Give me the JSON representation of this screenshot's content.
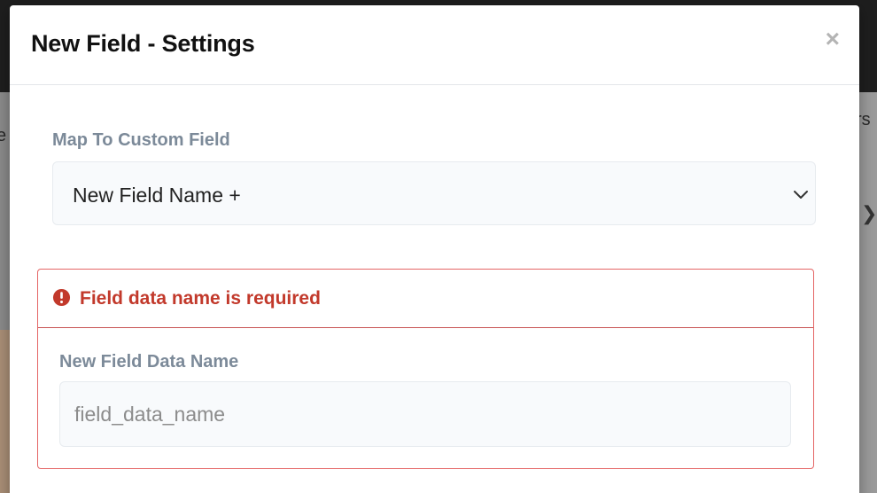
{
  "background": {
    "left_fragment": "e",
    "right_fragment": "rs",
    "right_arrow": "❯"
  },
  "modal": {
    "title": "New Field - Settings",
    "close_icon": "×"
  },
  "map_field": {
    "label": "Map To Custom Field",
    "selected_value": "New Field Name +"
  },
  "error": {
    "message": "Field data name is required",
    "color": "#c2392b"
  },
  "data_name_field": {
    "label": "New Field Data Name",
    "value": "",
    "placeholder": "field_data_name"
  }
}
